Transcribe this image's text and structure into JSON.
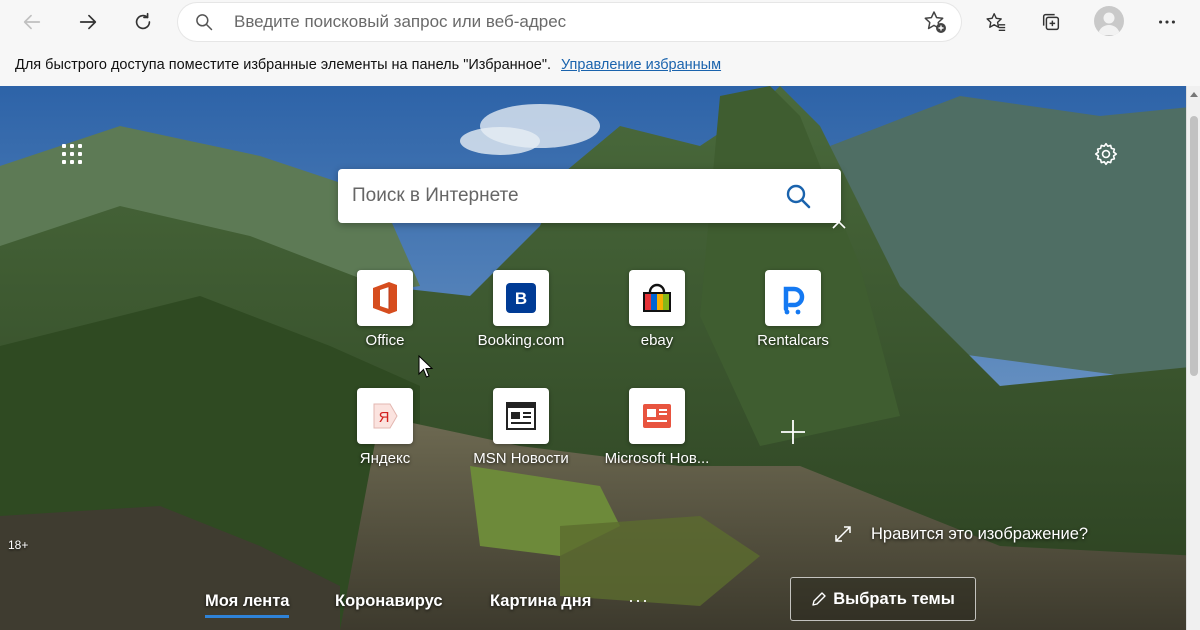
{
  "toolbar": {
    "address_placeholder": "Введите поисковый запрос или веб-адрес",
    "icons": [
      "back-arrow-icon",
      "forward-arrow-icon",
      "refresh-icon",
      "search-icon",
      "add-favorite-icon",
      "favorites-icon",
      "collections-icon",
      "profile-icon",
      "more-icon"
    ]
  },
  "favbar": {
    "message": "Для быстрого доступа поместите избранные элементы на панель \"Избранное\".",
    "manage_link": "Управление избранным"
  },
  "ntp": {
    "search_placeholder": "Поиск в Интернете",
    "tiles": [
      {
        "label": "Office",
        "icon": "office-icon"
      },
      {
        "label": "Booking.com",
        "icon": "booking-icon"
      },
      {
        "label": "ebay",
        "icon": "ebay-icon"
      },
      {
        "label": "Rentalcars",
        "icon": "rentalcars-icon"
      },
      {
        "label": "Яндекс",
        "icon": "yandex-icon"
      },
      {
        "label": "MSN Новости",
        "icon": "msn-news-icon"
      },
      {
        "label": "Microsoft Нов...",
        "icon": "microsoft-news-icon"
      }
    ],
    "age_badge": "18+",
    "like_image": "Нравится это изображение?",
    "nav": {
      "my_feed": "Моя лента",
      "coronavirus": "Коронавирус",
      "picture_of_day": "Картина дня",
      "more": "···",
      "choose_topics": "Выбрать темы"
    },
    "colors": {
      "accent": "#2f83d8",
      "link": "#1a63ad"
    }
  }
}
